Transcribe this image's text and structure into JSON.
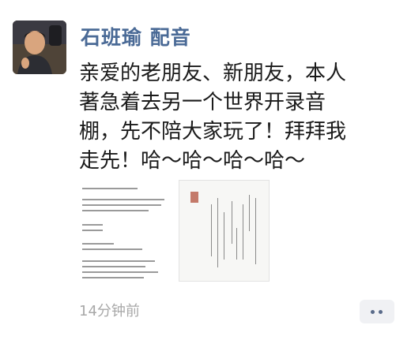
{
  "post": {
    "author_name": "石班瑜 配音",
    "text_lines": [
      "亲爱的老朋友、新朋友，本人",
      "著急着去另一个世界开录音",
      "棚，先不陪大家玩了！拜拜我",
      "走先！哈～哈～哈～哈～"
    ],
    "timestamp": "14分钟前"
  },
  "icons": {
    "avatar": "avatar-photo",
    "more": "more-dots-icon"
  },
  "colors": {
    "author_name": "#4a6a96",
    "timestamp": "#a8a8a8",
    "more_button_bg": "#f0f1f4"
  }
}
